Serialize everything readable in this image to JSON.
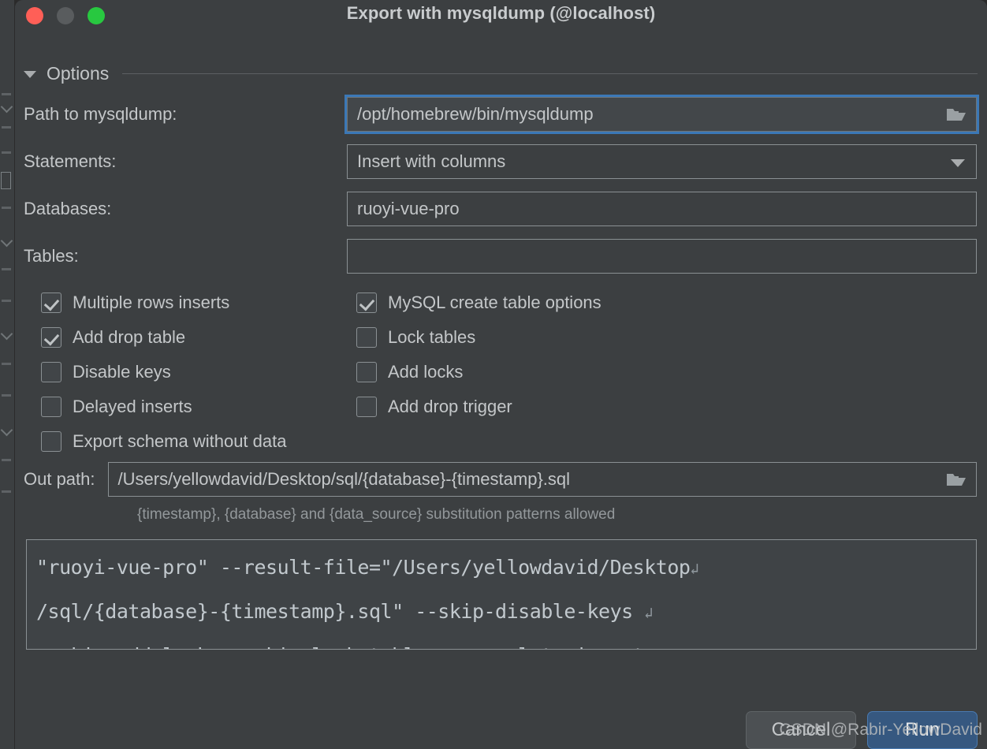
{
  "window": {
    "title": "Export with mysqldump (@localhost)",
    "traffic_lights": {
      "close": "close-button",
      "minimize": "minimize-button",
      "maximize": "maximize-button"
    }
  },
  "options_section": {
    "label": "Options",
    "expanded": true
  },
  "fields": [
    {
      "label": "Path to mysqldump:",
      "value": "/opt/homebrew/bin/mysqldump",
      "type": "text-with-browse",
      "focused": true,
      "icon": "folder-icon"
    },
    {
      "label": "Statements:",
      "value": "Insert with columns",
      "type": "dropdown",
      "focused": false,
      "icon": "chevron-down-icon"
    },
    {
      "label": "Databases:",
      "value": "ruoyi-vue-pro",
      "type": "text",
      "focused": false,
      "icon": ""
    },
    {
      "label": "Tables:",
      "value": "",
      "type": "text",
      "focused": false,
      "icon": ""
    }
  ],
  "checkboxes": {
    "left_column": [
      {
        "label": "Multiple rows inserts",
        "checked": true
      },
      {
        "label": "Add drop table",
        "checked": true
      },
      {
        "label": "Disable keys",
        "checked": false
      },
      {
        "label": "Delayed inserts",
        "checked": false
      },
      {
        "label": "Export schema without data",
        "checked": false
      }
    ],
    "right_column": [
      {
        "label": "MySQL create table options",
        "checked": true
      },
      {
        "label": "Lock tables",
        "checked": false
      },
      {
        "label": "Add locks",
        "checked": false
      },
      {
        "label": "Add drop trigger",
        "checked": false
      }
    ]
  },
  "out_path": {
    "label": "Out path:",
    "value": "/Users/yellowdavid/Desktop/sql/{database}-{timestamp}.sql",
    "icon": "folder-icon",
    "hint": "{timestamp}, {database} and {data_source} substitution patterns allowed"
  },
  "command_preview": {
    "lines": [
      "\"ruoyi-vue-pro\" --result-file=\"/Users/yellowdavid/Desktop",
      "/sql/{database}-{timestamp}.sql\" --skip-disable-keys ",
      "--skip-add-locks --skip-lock-tables --complete-insert"
    ],
    "wrap_marker": "↲"
  },
  "footer": {
    "cancel_label": "Cancel",
    "run_label": "Run"
  },
  "watermark": "CSDN @Rabir-YellowDavid",
  "colors": {
    "window_bg": "#3c3f41",
    "text": "#c4c7c9",
    "focus_ring": "#3b78b6",
    "run_button_bg": "#365880",
    "cancel_button_bg": "#4c5053",
    "border": "#8a9093",
    "hint_text": "#93989b",
    "traffic_close": "#ff5f57",
    "traffic_minimize": "#595c5e",
    "traffic_maximize": "#28c840"
  }
}
